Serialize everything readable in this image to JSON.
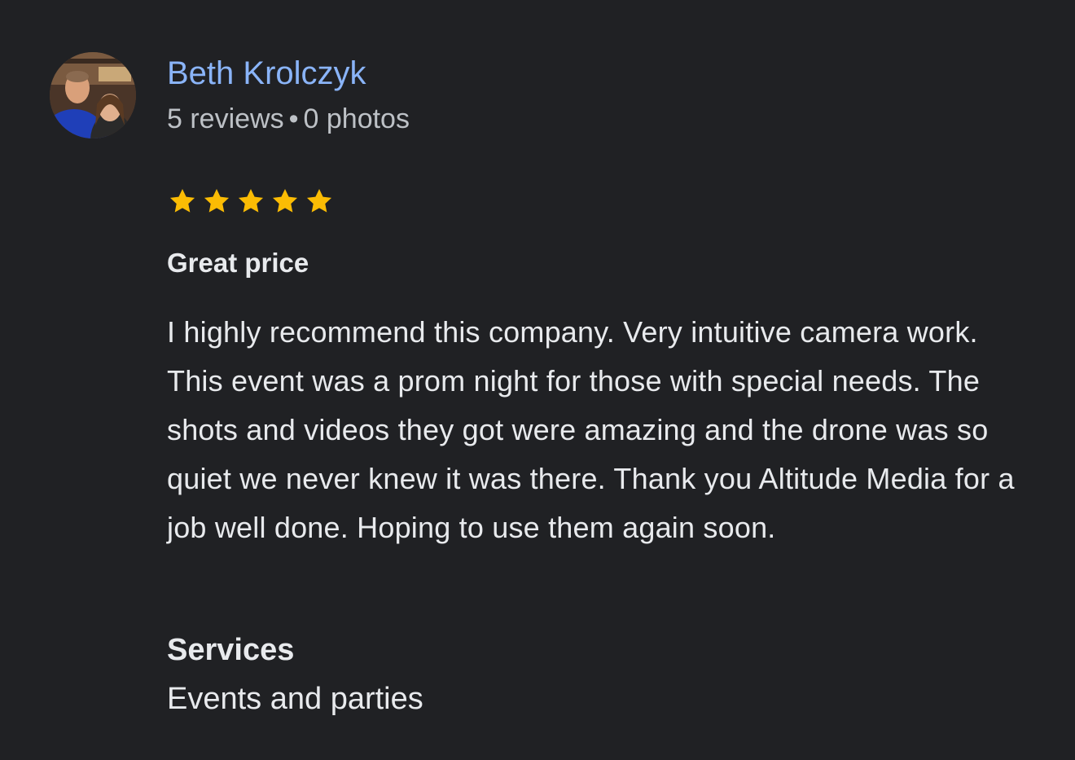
{
  "reviewer": {
    "name": "Beth Krolczyk",
    "reviews_count": "5 reviews",
    "separator": "•",
    "photos_count": "0 photos"
  },
  "rating": {
    "stars": 5,
    "max": 5,
    "star_color": "#fbbc04"
  },
  "review": {
    "title": "Great price",
    "body": "I highly recommend this company. Very intuitive camera work. This event was a prom night for those with special needs. The shots and videos they got were amazing and the drone was so quiet we never knew it was there. Thank you Altitude Media for a job well done. Hoping to use them again soon."
  },
  "services": {
    "heading": "Services",
    "value": "Events and parties"
  },
  "colors": {
    "background": "#202124",
    "name_link": "#8ab4f8",
    "text": "#e8eaed",
    "secondary_text": "#bdc1c6"
  }
}
